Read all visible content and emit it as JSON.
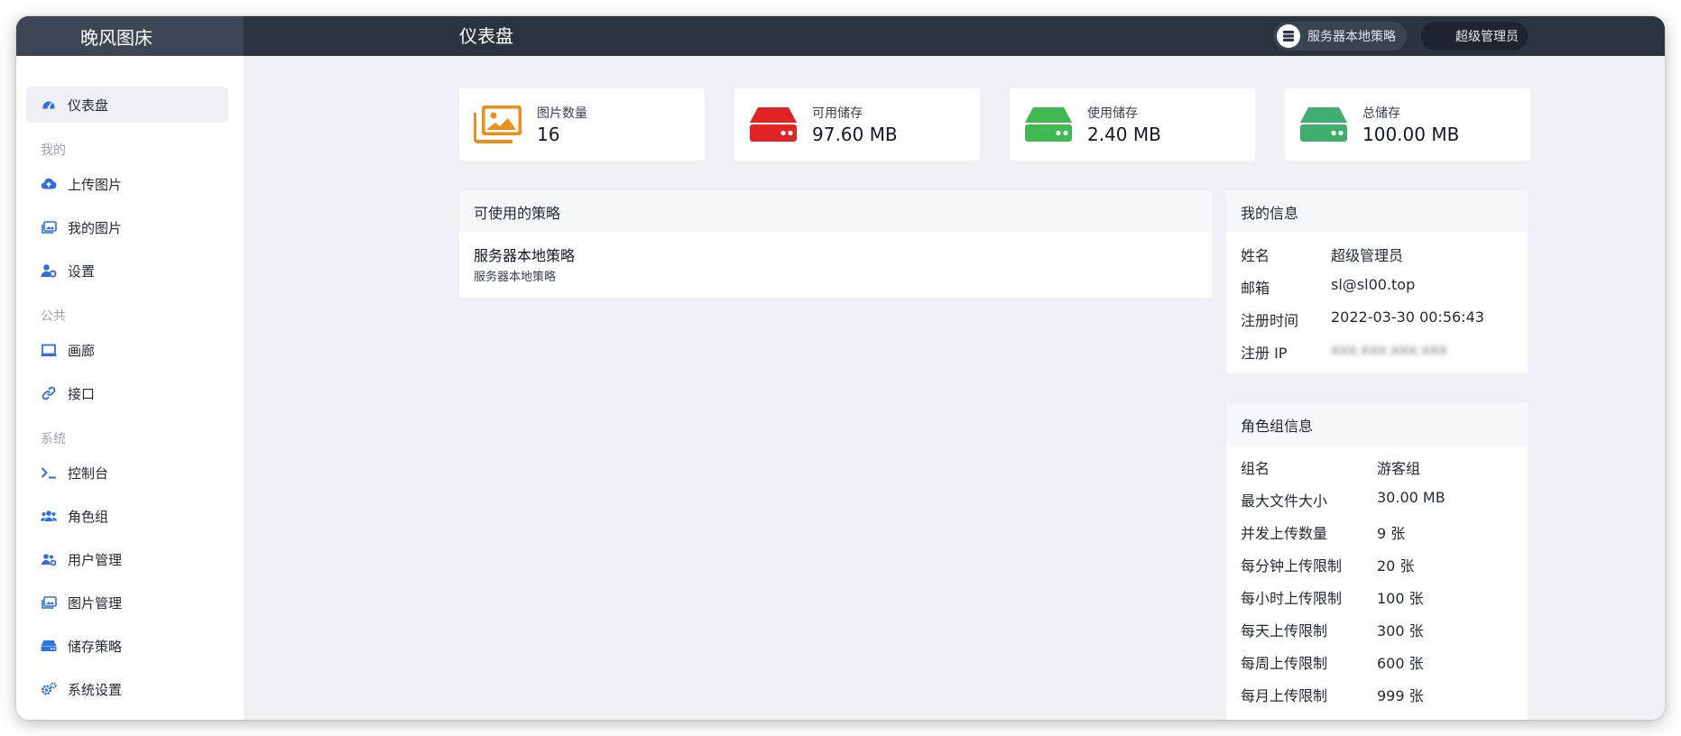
{
  "app": {
    "brand": "晚风图床",
    "page_title": "仪表盘"
  },
  "header": {
    "policy_label": "服务器本地策略",
    "user_label": "超级管理员"
  },
  "sidebar": {
    "dashboard": "仪表盘",
    "group_mine": "我的",
    "upload": "上传图片",
    "my_images": "我的图片",
    "settings": "设置",
    "group_public": "公共",
    "gallery": "画廊",
    "api": "接口",
    "group_system": "系统",
    "console": "控制台",
    "roles": "角色组",
    "users": "用户管理",
    "image_manage": "图片管理",
    "storage": "储存策略",
    "system_settings": "系统设置"
  },
  "stats": [
    {
      "label": "图片数量",
      "value": "16",
      "color": "#e8901a",
      "icon": "images-icon"
    },
    {
      "label": "可用储存",
      "value": "97.60 MB",
      "color": "#e02424",
      "icon": "hdd-icon"
    },
    {
      "label": "使用储存",
      "value": "2.40 MB",
      "color": "#3fb950",
      "icon": "hdd-icon"
    },
    {
      "label": "总储存",
      "value": "100.00 MB",
      "color": "#3fae6f",
      "icon": "hdd-icon"
    }
  ],
  "strategies": {
    "title": "可使用的策略",
    "item_name": "服务器本地策略",
    "item_desc": "服务器本地策略"
  },
  "my_info": {
    "title": "我的信息",
    "name_key": "姓名",
    "name_val": "超级管理员",
    "email_key": "邮箱",
    "email_val": "sl@sl00.top",
    "reg_time_key": "注册时间",
    "reg_time_val": "2022-03-30 00:56:43",
    "reg_ip_key": "注册 IP",
    "reg_ip_val": "xxx.xxx.xxx.xxx"
  },
  "role_info": {
    "title": "角色组信息",
    "rows": [
      {
        "k": "组名",
        "v": "游客组"
      },
      {
        "k": "最大文件大小",
        "v": "30.00 MB"
      },
      {
        "k": "并发上传数量",
        "v": "9 张"
      },
      {
        "k": "每分钟上传限制",
        "v": "20 张"
      },
      {
        "k": "每小时上传限制",
        "v": "100 张"
      },
      {
        "k": "每天上传限制",
        "v": "300 张"
      },
      {
        "k": "每周上传限制",
        "v": "600 张"
      },
      {
        "k": "每月上传限制",
        "v": "999 张"
      }
    ]
  },
  "colors": {
    "accent": "#2f6fe0",
    "topbar": "#2b3340",
    "page_bg": "#eef0f5"
  }
}
